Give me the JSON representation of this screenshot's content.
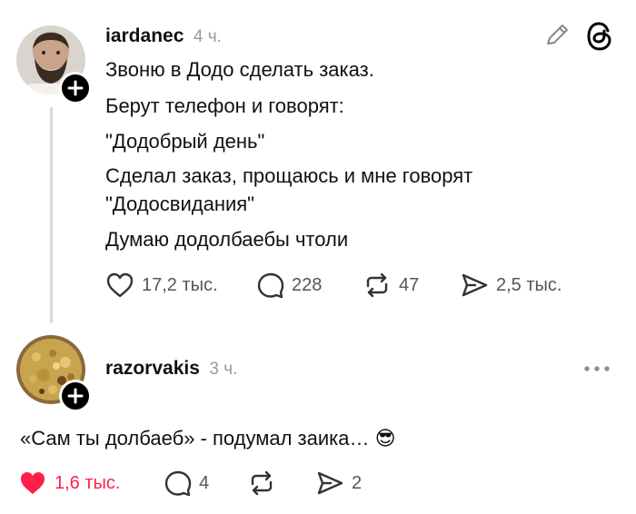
{
  "post": {
    "username": "iardanec",
    "time": "4 ч.",
    "lines": [
      "Звоню в Додо сделать заказ.",
      "Берут телефон и говорят:",
      "\"Додобрый день\"",
      "Сделал заказ, прощаюсь и мне говорят",
      "\"Додосвидания\"",
      "Думаю додолбаебы чтоли"
    ],
    "actions": {
      "likes": "17,2 тыс.",
      "comments": "228",
      "reposts": "47",
      "shares": "2,5 тыс."
    },
    "icons": [
      "pencil-icon",
      "threads-logo-icon",
      "heart-icon",
      "comment-icon",
      "repost-icon",
      "send-icon"
    ]
  },
  "reply": {
    "username": "razorvakis",
    "time": "3 ч.",
    "text": "«Сам ты долбаеб» - подумал заика… ",
    "emoji": "😎",
    "actions": {
      "likes": "1,6 тыс.",
      "comments": "4",
      "reposts": "",
      "shares": "2"
    },
    "liked": true,
    "icons": [
      "more-icon",
      "heart-filled-icon",
      "comment-icon",
      "repost-icon",
      "send-icon"
    ]
  },
  "colors": {
    "like_active": "#ff1f4b",
    "muted": "#9a9a9a",
    "text": "#111111"
  }
}
